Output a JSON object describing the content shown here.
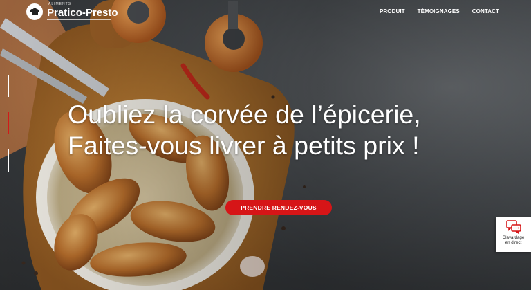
{
  "header": {
    "logo_tagline": "ALIMENTS",
    "logo_name": "Pratico-Presto",
    "nav": [
      {
        "label": "PRODUIT"
      },
      {
        "label": "TÉMOIGNAGES"
      },
      {
        "label": "CONTACT"
      }
    ]
  },
  "hero": {
    "headline_line1": "Oubliez la corvée de l’épicerie,",
    "headline_line2": "Faites-vous livrer à petits prix !",
    "cta_label": "PRENDRE RENDEZ-VOUS",
    "active_slide": 2,
    "slide_count": 3
  },
  "chat": {
    "label_line1": "Clavardage",
    "label_line2": "en direct",
    "icon": "chat-bubbles-icon"
  },
  "colors": {
    "accent": "#d61517",
    "text": "#ffffff"
  }
}
